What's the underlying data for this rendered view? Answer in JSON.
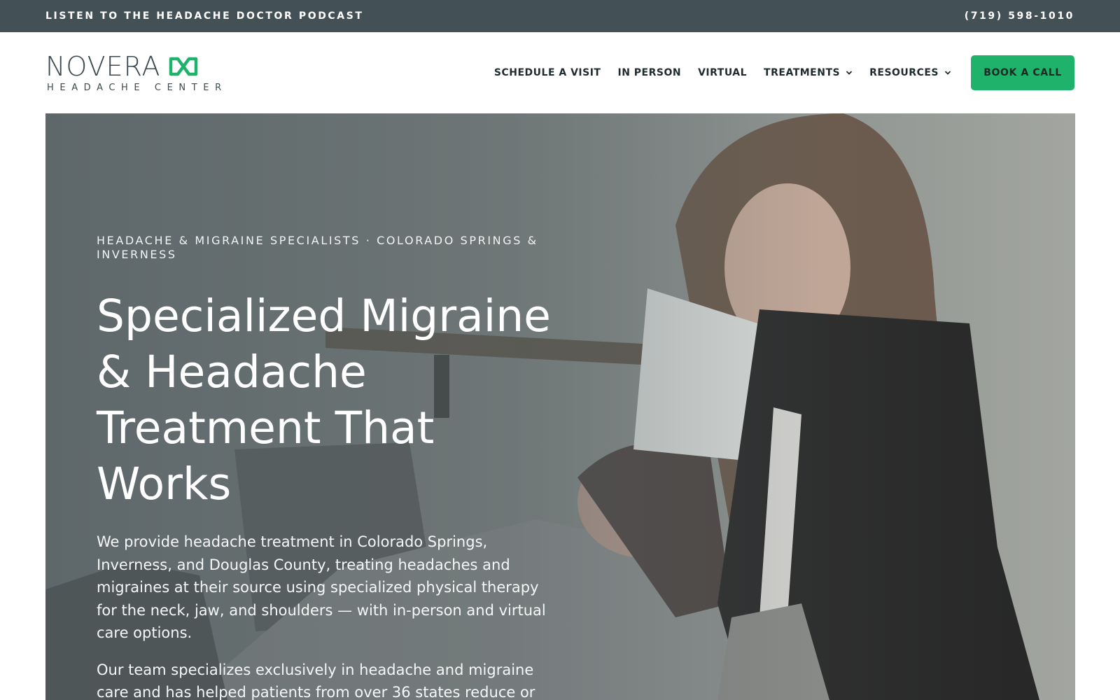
{
  "topbar": {
    "podcast_link": "LISTEN TO THE HEADACHE DOCTOR PODCAST",
    "phone": "(719) 598-1010"
  },
  "brand": {
    "name": "NOVERA",
    "tagline": "HEADACHE CENTER",
    "logo_icon": "infinity-knot-icon",
    "accent_color": "#1fb26b"
  },
  "nav": {
    "items": [
      {
        "label": "SCHEDULE A VISIT"
      },
      {
        "label": "IN PERSON"
      },
      {
        "label": "VIRTUAL"
      },
      {
        "label": "TREATMENTS",
        "icon": "chevron-down-icon"
      },
      {
        "label": "RESOURCES",
        "icon": "chevron-down-icon"
      }
    ],
    "cta_label": "BOOK A CALL"
  },
  "hero": {
    "eyebrow": "HEADACHE & MIGRAINE SPECIALISTS · COLORADO SPRINGS & INVERNESS",
    "title": "Specialized Migraine & Headache Treatment That Works",
    "paragraph_1": "We provide headache treatment in Colorado Springs, Inverness, and Douglas County, treating headaches and migraines at their source using specialized physical therapy for the neck, jaw, and shoulders — with in-person and virtual care options.",
    "paragraph_2": "Our team specializes exclusively in headache and migraine care and has helped patients from over 36 states reduce or"
  },
  "colors": {
    "topbar_bg": "#435156",
    "text_dark": "#1f2a2e",
    "cta_bg": "#1fb26b"
  }
}
